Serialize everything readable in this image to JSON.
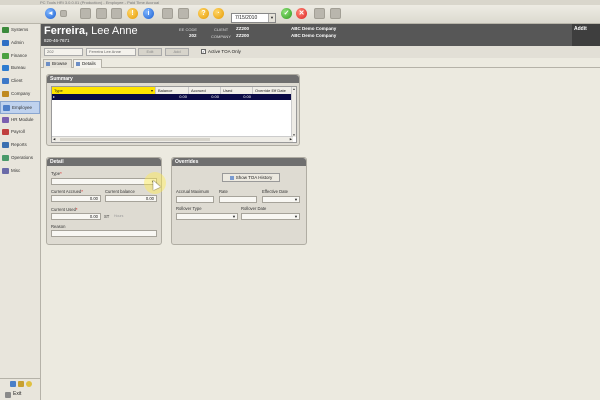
{
  "window": {
    "title": "PC Tools HRi 3.0.0.01 (Production) - Employee - Paid Time Accrual"
  },
  "toolbar": {
    "date": "7/15/2010",
    "icons": [
      "back-icon",
      "forward-icon",
      "save-icon",
      "help-icon",
      "ok-icon",
      "cancel-icon"
    ]
  },
  "nav": {
    "items": [
      {
        "label": "Systems",
        "color": "#3b8a3b"
      },
      {
        "label": "Admin",
        "color": "#2f6fc4"
      },
      {
        "label": "Finance",
        "color": "#4aa040"
      },
      {
        "label": "Bureau",
        "color": "#2e7cd0"
      },
      {
        "label": "Client",
        "color": "#3c78c8"
      },
      {
        "label": "Company",
        "color": "#c08a20"
      },
      {
        "label": "Employee",
        "color": "#4f7fc8"
      },
      {
        "label": "HR Module",
        "color": "#7a5fb0"
      },
      {
        "label": "Payroll",
        "color": "#c04040"
      },
      {
        "label": "Reports",
        "color": "#3a6fb0"
      },
      {
        "label": "Operations",
        "color": "#4a9a6a"
      },
      {
        "label": "Misc",
        "color": "#6a6aa8"
      }
    ],
    "active_index": 6,
    "exit_label": "Exit"
  },
  "header": {
    "last_name": "Ferreira",
    "first_name": "Lee Anne",
    "ssn": "820-46-7671",
    "ee_code_label": "EE CODE",
    "ee_code_value": "202",
    "client_label": "CLIENT",
    "client_code": "ZZ200",
    "client_name": "ABC Demo Company",
    "company_label": "COMPANY",
    "company_code": "ZZ200",
    "company_name": "ABC Demo Company",
    "right_label": "Addit"
  },
  "subtoolbar": {
    "code_field": "202",
    "name_field": "Ferreira Lee Anne",
    "btn_edit": "Edit",
    "btn_add": "Add",
    "active_checkbox_label": "Active TOA Only",
    "active_checked": true
  },
  "tabs": [
    {
      "label": "Browse",
      "active": false
    },
    {
      "label": "Details",
      "active": true
    }
  ],
  "summary": {
    "title": "Summary",
    "columns": [
      "Type",
      "Balance",
      "Accrued",
      "Used",
      "Override Eff Date"
    ],
    "row": [
      "",
      "0.00",
      "0.00",
      "0.00",
      ""
    ]
  },
  "detail": {
    "title": "Detail",
    "type_label": "Type",
    "type_value": "",
    "current_accrued_label": "Current Accrued",
    "current_accrued_value": "0.00",
    "current_balance_label": "Current balance",
    "current_balance_value": "0.00",
    "current_used_label": "Current Used",
    "current_used_value": "0.00",
    "used_unit": "ST",
    "used_unit_suffix": "Hours",
    "reason_label": "Reason",
    "reason_value": ""
  },
  "overrides": {
    "title": "Overrides",
    "show_history_button": "Show TOA History",
    "accrual_max_label": "Accrual Maximum",
    "rate_label": "Rate",
    "effective_date_label": "Effective Date",
    "rollover_type_label": "Rollover Type",
    "rollover_date_label": "Rollover Date"
  }
}
